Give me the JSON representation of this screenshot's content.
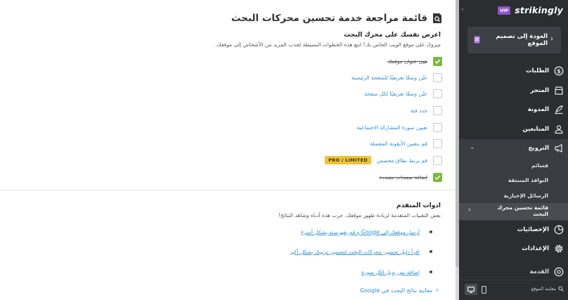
{
  "main": {
    "page_title": "قائمة مراجعة خدمة تحسين محركات البحث",
    "section1": {
      "title": "اعرض نفسك على محرك البحث",
      "description": "مبروك على موقع الويب الخاص بك! اتبع هذه الخطوات البسيطة لجذب المزيد من الأشخاص إلى موقعك.",
      "tasks": [
        {
          "label": "هيئ عنوان موقعك",
          "checked": true
        },
        {
          "label": "عيّن وصفًا تعريفيًا للصفحة الرئيسية",
          "checked": false
        },
        {
          "label": "عيّن وصفًا تعريفيًا لكل صفحة",
          "checked": false
        },
        {
          "label": "حدد فئة",
          "checked": false
        },
        {
          "label": "تعيين صورة المشاركة الاجتماعية",
          "checked": false
        },
        {
          "label": "قم بتعيين الأيقونة المفضلة",
          "checked": false
        },
        {
          "label": "قم بربط نطاق مخصص",
          "checked": false,
          "badge": "PRO / LIMITED"
        },
        {
          "label": "إضافة صفحات متعددة",
          "checked": true
        }
      ]
    },
    "section2": {
      "title": "ادوات المتقدم",
      "description": "بعض التقنيات المتقدمة لزيادة ظهور موقعك. جرب هذه أدناه وشاهد النتائج!",
      "items": [
        "أرسل موقعك إلى Google و قم بفهرسته بشكل أسرع",
        "اقرأ دليل تحسين محركات البحث لتحسين ترتيبك بشكل أكبر",
        "إضافة نص بديل لكل صورة"
      ]
    },
    "preview_link": "معاينة نتائج البحث في Google"
  },
  "sidebar": {
    "vip_badge": "VIP",
    "logo": "strikingly",
    "back_label": "العودة إلى تصميم الموقع",
    "items": [
      {
        "label": "الطلبات",
        "icon": "dollar-circle-icon"
      },
      {
        "label": "المتجر",
        "icon": "store-icon"
      },
      {
        "label": "المدونة",
        "icon": "quill-icon"
      },
      {
        "label": "المتابعين",
        "icon": "people-icon"
      },
      {
        "label": "الترويج",
        "icon": "megaphone-icon"
      }
    ],
    "promote_sub": [
      "قسائم",
      "النوافذ المنبثقة",
      "الرسائل الإخبارية",
      "قائمة تحسين محرك البحث"
    ],
    "items2": [
      {
        "label": "الإحصائيات",
        "icon": "pie-chart-icon"
      },
      {
        "label": "الإعدادات",
        "icon": "gear-icon"
      },
      {
        "label": "القدمة",
        "icon": "help-icon"
      }
    ],
    "preview_site": "معاينة الموقع"
  },
  "colors": {
    "sidebar_bg": "#2b2d31",
    "check_green": "#7bb93d",
    "link_blue": "#2d8fd5",
    "badge_yellow": "#f2c230",
    "vip_purple": "#8c55c6"
  }
}
